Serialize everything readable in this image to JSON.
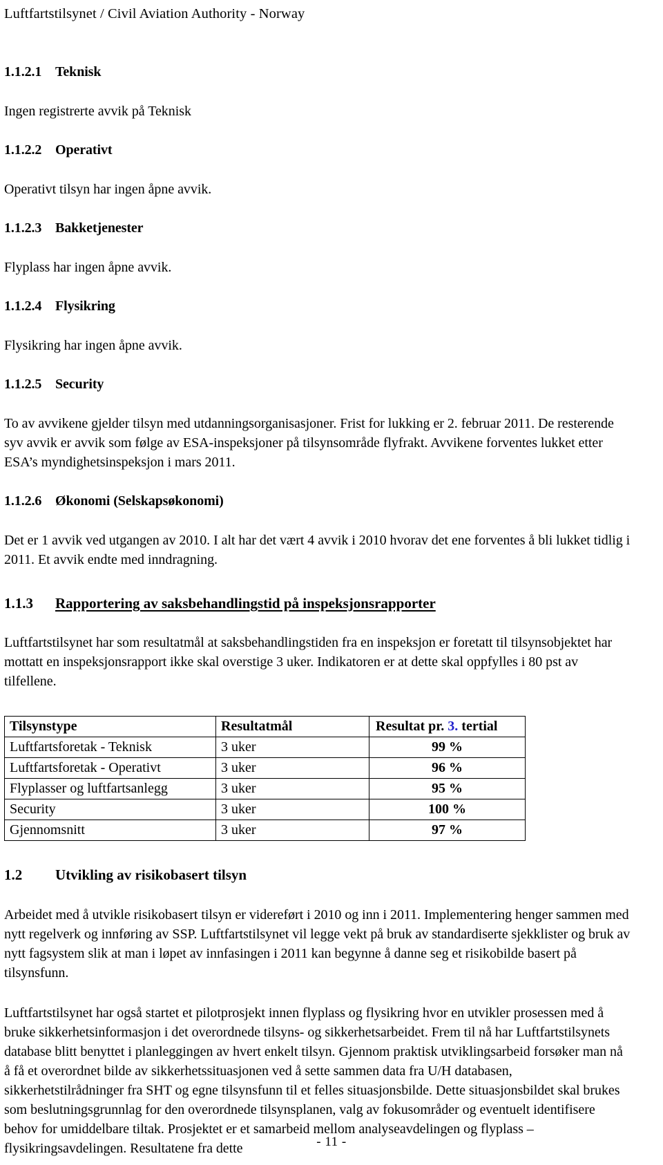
{
  "document": {
    "running_header": "Luftfartstilsynet / Civil Aviation Authority - Norway",
    "page_footer": "- 11 -"
  },
  "theme": {
    "text_color": "#000000",
    "accent_color": "#2222cc",
    "page_background": "#ffffff",
    "table_border_color": "#000000"
  },
  "sections": {
    "teknisk": {
      "number": "1.1.2.1",
      "title": "Teknisk",
      "body": "Ingen registrerte avvik på Teknisk"
    },
    "operativt": {
      "number": "1.1.2.2",
      "title": "Operativt",
      "body": "Operativt tilsyn har ingen åpne avvik."
    },
    "bakketjenester": {
      "number": "1.1.2.3",
      "title": "Bakketjenester",
      "body": "Flyplass har ingen åpne avvik."
    },
    "flysikring": {
      "number": "1.1.2.4",
      "title": "Flysikring",
      "body": "Flysikring har ingen åpne avvik."
    },
    "security": {
      "number": "1.1.2.5",
      "title": "Security",
      "body": "To av avvikene gjelder tilsyn med utdanningsorganisasjoner. Frist for lukking er 2. februar 2011.  De resterende syv avvik er avvik som følge av ESA-inspeksjoner på tilsynsområde flyfrakt. Avvikene forventes lukket etter ESA’s myndighetsinspeksjon i mars 2011."
    },
    "okonomi": {
      "number": "1.1.2.6",
      "title": "Økonomi (Selskapsøkonomi)",
      "body": "Det er 1 avvik ved utgangen av 2010. I alt har det vært 4 avvik i 2010 hvorav det ene forventes å bli lukket tidlig i 2011. Et avvik endte med inndragning."
    },
    "rapportering": {
      "number": "1.1.3",
      "title": "Rapportering av saksbehandlingstid på inspeksjonsrapporter",
      "body": "Luftfartstilsynet har som resultatmål at saksbehandlingstiden fra en inspeksjon er foretatt til tilsynsobjektet har mottatt en inspeksjonsrapport ikke skal overstige 3 uker. Indikatoren er at dette skal oppfylles i 80 pst av tilfellene."
    },
    "risikobasert": {
      "number": "1.2",
      "title": "Utvikling av risikobasert tilsyn",
      "body_1": "Arbeidet med å utvikle risikobasert tilsyn er videreført i 2010 og inn i 2011. Implementering henger sammen med nytt regelverk og innføring av SSP. Luftfartstilsynet vil legge vekt på bruk av standardiserte sjekklister og bruk av nytt fagsystem slik at man i løpet av innfasingen i 2011 kan begynne å danne seg et risikobilde basert på tilsynsfunn.",
      "body_2": "Luftfartstilsynet har også startet et pilotprosjekt innen flyplass og flysikring hvor en utvikler prosessen med å bruke sikkerhetsinformasjon i det overordnede tilsyns- og sikkerhetsarbeidet. Frem til nå har Luftfartstilsynets database blitt benyttet i planleggingen av hvert enkelt tilsyn. Gjennom praktisk utviklingsarbeid forsøker man nå å få et overordnet bilde av sikkerhetssituasjonen ved å sette sammen data fra U/H databasen, sikkerhetstilrådninger fra SHT og egne tilsynsfunn til et felles situasjonsbilde. Dette situasjonsbildet skal brukes som beslutningsgrunnlag for den overordnede tilsynsplanen, valg av fokusområder og eventuelt identifisere behov for umiddelbare tiltak. Prosjektet er et samarbeid mellom analyseavdelingen og flyplass – flysikringsavdelingen. Resultatene fra dette"
    }
  },
  "result_table": {
    "headers": {
      "col1": "Tilsynstype",
      "col2": "Resultatmål",
      "col3_prefix": "Resultat pr. ",
      "col3_number": "3.",
      "col3_suffix": " tertial"
    },
    "rows": [
      {
        "tilsynstype": "Luftfartsforetak - Teknisk",
        "resultatmal": "3 uker",
        "resultat": "99 %"
      },
      {
        "tilsynstype": "Luftfartsforetak - Operativt",
        "resultatmal": "3 uker",
        "resultat": "96 %"
      },
      {
        "tilsynstype": "Flyplasser og luftfartsanlegg",
        "resultatmal": "3 uker",
        "resultat": "95 %"
      },
      {
        "tilsynstype": "Security",
        "resultatmal": "3 uker",
        "resultat": "100 %"
      },
      {
        "tilsynstype": "Gjennomsnitt",
        "resultatmal": "3 uker",
        "resultat": "97 %"
      }
    ]
  }
}
